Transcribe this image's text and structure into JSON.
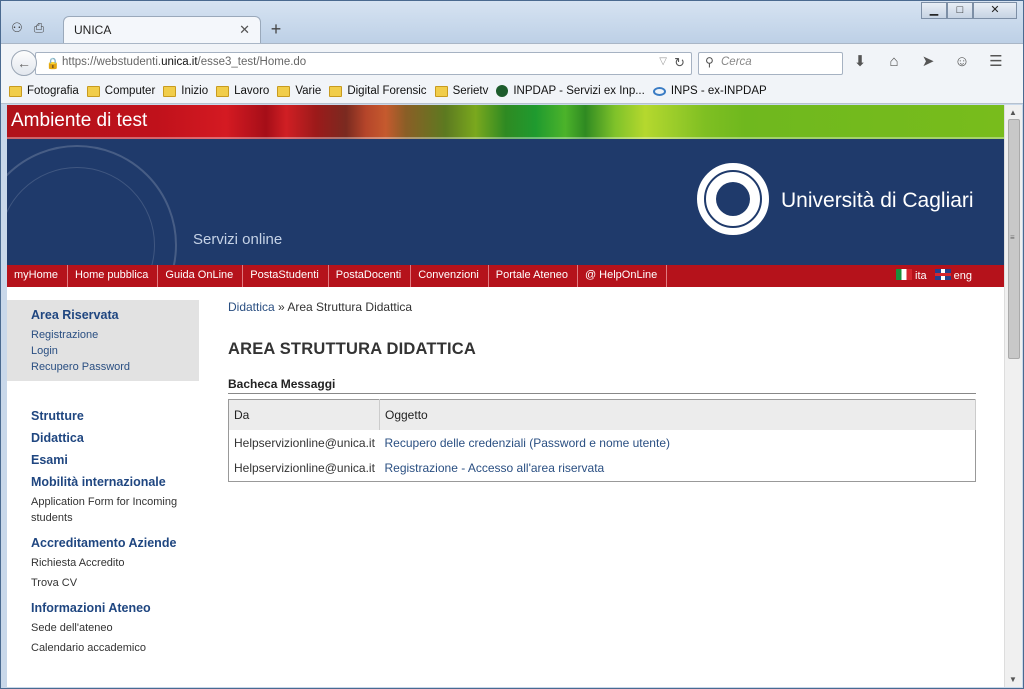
{
  "browser": {
    "tab_title": "UNICA",
    "url_prefix": "https://webstudenti.",
    "url_host": "unica.it",
    "url_path": "/esse3_test/Home.do",
    "search_placeholder": "Cerca",
    "bookmarks": [
      {
        "label": "Fotografia",
        "icon": "folder-icon"
      },
      {
        "label": "Computer",
        "icon": "folder-icon"
      },
      {
        "label": "Inizio",
        "icon": "folder-icon"
      },
      {
        "label": "Lavoro",
        "icon": "folder-icon"
      },
      {
        "label": "Varie",
        "icon": "folder-icon"
      },
      {
        "label": "Digital Forensic",
        "icon": "folder-icon"
      },
      {
        "label": "Serietv",
        "icon": "folder-icon"
      },
      {
        "label": "INPDAP - Servizi ex Inp...",
        "icon": "inpdap-icon"
      },
      {
        "label": "INPS - ex-INPDAP",
        "icon": "inps-icon"
      }
    ]
  },
  "site": {
    "test_banner": "Ambiente di test",
    "services_label": "Servizi online",
    "university_name": "Università di Cagliari",
    "menu": [
      "myHome",
      "Home pubblica",
      "Guida OnLine",
      "PostaStudenti",
      "PostaDocenti",
      "Convenzioni",
      "Portale Ateneo",
      "@ HelpOnLine"
    ],
    "lang_it": "ita",
    "lang_en": "eng",
    "brand_red": "#b5121b",
    "brand_blue": "#1f3a6b"
  },
  "sidebar": {
    "riservata_title": "Area Riservata",
    "riservata_links": [
      "Registrazione",
      "Login",
      "Recupero Password"
    ],
    "sections": [
      {
        "title": "Strutture",
        "links": []
      },
      {
        "title": "Didattica",
        "links": []
      },
      {
        "title": "Esami",
        "links": []
      },
      {
        "title": "Mobilità internazionale",
        "links": [
          "Application Form for Incoming students"
        ]
      },
      {
        "title": "Accreditamento Aziende",
        "links": [
          "Richiesta Accredito",
          "Trova CV"
        ]
      },
      {
        "title": "Informazioni Ateneo",
        "links": [
          "Sede dell'ateneo",
          "Calendario accademico"
        ]
      }
    ]
  },
  "main": {
    "crumb_link": "Didattica",
    "crumb_sep": " » ",
    "crumb_current": "Area Struttura Didattica",
    "title": "AREA STRUTTURA DIDATTICA",
    "board_title": "Bacheca Messaggi",
    "columns": [
      "Da",
      "Oggetto"
    ],
    "rows": [
      {
        "from": "Helpservizionline@unica.it",
        "subject": "Recupero delle credenziali (Password e nome utente)"
      },
      {
        "from": "Helpservizionline@unica.it",
        "subject": "Registrazione - Accesso all'area riservata"
      }
    ]
  }
}
